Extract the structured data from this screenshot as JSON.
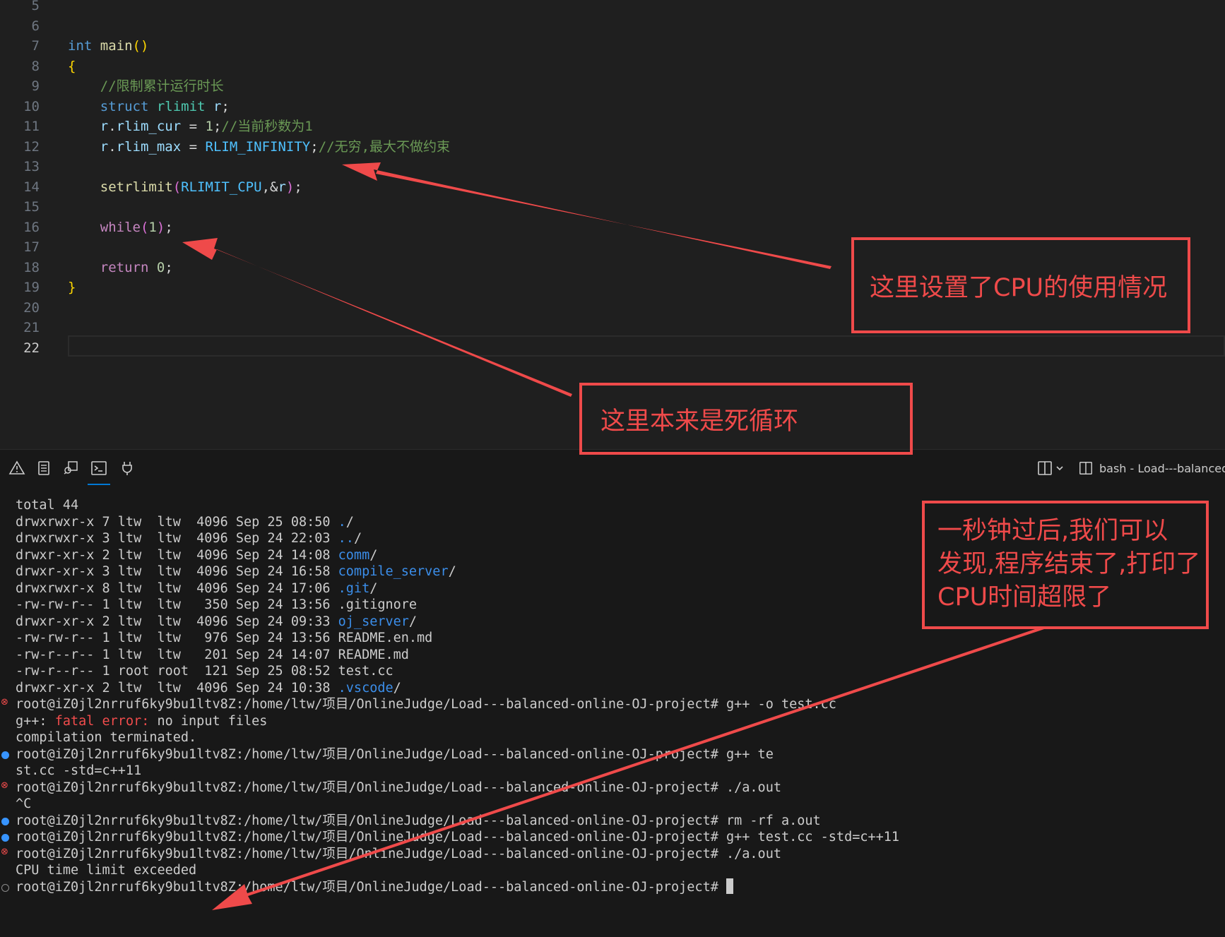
{
  "editor": {
    "lines": [
      {
        "n": "5",
        "tokens": []
      },
      {
        "n": "6",
        "tokens": []
      },
      {
        "n": "7",
        "tokens": [
          [
            "kw",
            "int"
          ],
          [
            "op",
            " "
          ],
          [
            "fn",
            "main"
          ],
          [
            "br",
            "()"
          ]
        ]
      },
      {
        "n": "8",
        "tokens": [
          [
            "br",
            "{"
          ]
        ]
      },
      {
        "n": "9",
        "tokens": [
          [
            "op",
            "    "
          ],
          [
            "cmt",
            "//限制累计运行时长"
          ]
        ]
      },
      {
        "n": "10",
        "tokens": [
          [
            "op",
            "    "
          ],
          [
            "kw",
            "struct"
          ],
          [
            "op",
            " "
          ],
          [
            "typ",
            "rlimit"
          ],
          [
            "op",
            " "
          ],
          [
            "var",
            "r"
          ],
          [
            "op",
            ";"
          ]
        ]
      },
      {
        "n": "11",
        "tokens": [
          [
            "op",
            "    "
          ],
          [
            "var",
            "r"
          ],
          [
            "op",
            "."
          ],
          [
            "var",
            "rlim_cur"
          ],
          [
            "op",
            " = "
          ],
          [
            "num",
            "1"
          ],
          [
            "op",
            ";"
          ],
          [
            "cmt",
            "//当前秒数为1"
          ]
        ]
      },
      {
        "n": "12",
        "tokens": [
          [
            "op",
            "    "
          ],
          [
            "var",
            "r"
          ],
          [
            "op",
            "."
          ],
          [
            "var",
            "rlim_max"
          ],
          [
            "op",
            " = "
          ],
          [
            "mac",
            "RLIM_INFINITY"
          ],
          [
            "op",
            ";"
          ],
          [
            "cmt",
            "//无穷,最大不做约束"
          ]
        ]
      },
      {
        "n": "13",
        "tokens": []
      },
      {
        "n": "14",
        "tokens": [
          [
            "op",
            "    "
          ],
          [
            "fn",
            "setrlimit"
          ],
          [
            "br2",
            "("
          ],
          [
            "mac",
            "RLIMIT_CPU"
          ],
          [
            "op",
            ",&"
          ],
          [
            "var",
            "r"
          ],
          [
            "br2",
            ")"
          ],
          [
            "op",
            ";"
          ]
        ]
      },
      {
        "n": "15",
        "tokens": []
      },
      {
        "n": "16",
        "tokens": [
          [
            "op",
            "    "
          ],
          [
            "ctl",
            "while"
          ],
          [
            "br2",
            "("
          ],
          [
            "num",
            "1"
          ],
          [
            "br2",
            ")"
          ],
          [
            "op",
            ";"
          ]
        ]
      },
      {
        "n": "17",
        "tokens": []
      },
      {
        "n": "18",
        "tokens": [
          [
            "op",
            "    "
          ],
          [
            "ctl",
            "return"
          ],
          [
            "op",
            " "
          ],
          [
            "num",
            "0"
          ],
          [
            "op",
            ";"
          ]
        ]
      },
      {
        "n": "19",
        "tokens": [
          [
            "br",
            "}"
          ]
        ]
      },
      {
        "n": "20",
        "tokens": []
      },
      {
        "n": "21",
        "tokens": []
      },
      {
        "n": "22",
        "tokens": []
      }
    ],
    "active_line": "22"
  },
  "panel": {
    "tab_icons": [
      "warning-icon",
      "output-icon",
      "debug-console-icon",
      "terminal-icon",
      "ports-icon"
    ],
    "terminal_title": "bash - Load---balanced-"
  },
  "terminal": {
    "lines": [
      {
        "deco": "",
        "segs": [
          [
            "",
            "total 44"
          ]
        ]
      },
      {
        "deco": "",
        "segs": [
          [
            "",
            "drwxrwxr-x 7 ltw  ltw  4096 Sep 25 08:50 "
          ],
          [
            "tdir",
            "."
          ],
          [
            "",
            "/"
          ]
        ]
      },
      {
        "deco": "",
        "segs": [
          [
            "",
            "drwxrwxr-x 3 ltw  ltw  4096 Sep 24 22:03 "
          ],
          [
            "tdir",
            ".."
          ],
          [
            "",
            "/"
          ]
        ]
      },
      {
        "deco": "",
        "segs": [
          [
            "",
            "drwxr-xr-x 2 ltw  ltw  4096 Sep 24 14:08 "
          ],
          [
            "tdir",
            "comm"
          ],
          [
            "",
            "/"
          ]
        ]
      },
      {
        "deco": "",
        "segs": [
          [
            "",
            "drwxr-xr-x 3 ltw  ltw  4096 Sep 24 16:58 "
          ],
          [
            "tdir",
            "compile_server"
          ],
          [
            "",
            "/"
          ]
        ]
      },
      {
        "deco": "",
        "segs": [
          [
            "",
            "drwxrwxr-x 8 ltw  ltw  4096 Sep 24 17:06 "
          ],
          [
            "tdir",
            ".git"
          ],
          [
            "",
            "/"
          ]
        ]
      },
      {
        "deco": "",
        "segs": [
          [
            "",
            "-rw-rw-r-- 1 ltw  ltw   350 Sep 24 13:56 .gitignore"
          ]
        ]
      },
      {
        "deco": "",
        "segs": [
          [
            "",
            "drwxr-xr-x 2 ltw  ltw  4096 Sep 24 09:33 "
          ],
          [
            "tdir",
            "oj_server"
          ],
          [
            "",
            "/"
          ]
        ]
      },
      {
        "deco": "",
        "segs": [
          [
            "",
            "-rw-rw-r-- 1 ltw  ltw   976 Sep 24 13:56 README.en.md"
          ]
        ]
      },
      {
        "deco": "",
        "segs": [
          [
            "",
            "-rw-r--r-- 1 ltw  ltw   201 Sep 24 14:07 README.md"
          ]
        ]
      },
      {
        "deco": "",
        "segs": [
          [
            "",
            "-rw-r--r-- 1 root root  121 Sep 25 08:52 test.cc"
          ]
        ]
      },
      {
        "deco": "",
        "segs": [
          [
            "",
            "drwxr-xr-x 2 ltw  ltw  4096 Sep 24 10:38 "
          ],
          [
            "tdir",
            ".vscode"
          ],
          [
            "",
            "/"
          ]
        ]
      },
      {
        "deco": "err",
        "segs": [
          [
            "",
            "root@iZ0jl2nrruf6ky9bu1ltv8Z:/home/ltw/项目/OnlineJudge/Load---balanced-online-OJ-project# g++ -o test.cc"
          ]
        ]
      },
      {
        "deco": "",
        "segs": [
          [
            "",
            "g++: "
          ],
          [
            "tred",
            "fatal error:"
          ],
          [
            "",
            " no input files"
          ]
        ]
      },
      {
        "deco": "",
        "segs": [
          [
            "",
            "compilation terminated."
          ]
        ]
      },
      {
        "deco": "ok",
        "segs": [
          [
            "",
            "root@iZ0jl2nrruf6ky9bu1ltv8Z:/home/ltw/项目/OnlineJudge/Load---balanced-online-OJ-project# g++ te"
          ]
        ]
      },
      {
        "deco": "",
        "segs": [
          [
            "",
            "st.cc -std=c++11"
          ]
        ]
      },
      {
        "deco": "err",
        "segs": [
          [
            "",
            "root@iZ0jl2nrruf6ky9bu1ltv8Z:/home/ltw/项目/OnlineJudge/Load---balanced-online-OJ-project# ./a.out"
          ]
        ]
      },
      {
        "deco": "",
        "segs": [
          [
            "",
            "^C"
          ]
        ]
      },
      {
        "deco": "ok",
        "segs": [
          [
            "",
            "root@iZ0jl2nrruf6ky9bu1ltv8Z:/home/ltw/项目/OnlineJudge/Load---balanced-online-OJ-project# rm -rf a.out"
          ]
        ]
      },
      {
        "deco": "ok",
        "segs": [
          [
            "",
            "root@iZ0jl2nrruf6ky9bu1ltv8Z:/home/ltw/项目/OnlineJudge/Load---balanced-online-OJ-project# g++ test.cc -std=c++11"
          ]
        ]
      },
      {
        "deco": "err",
        "segs": [
          [
            "",
            "root@iZ0jl2nrruf6ky9bu1ltv8Z:/home/ltw/项目/OnlineJudge/Load---balanced-online-OJ-project# ./a.out"
          ]
        ]
      },
      {
        "deco": "",
        "segs": [
          [
            "",
            "CPU time limit exceeded"
          ]
        ]
      },
      {
        "deco": "idle",
        "segs": [
          [
            "",
            "root@iZ0jl2nrruf6ky9bu1ltv8Z:/home/ltw/项目/OnlineJudge/Load---balanced-online-OJ-project# "
          ]
        ],
        "cursor": true
      }
    ]
  },
  "annotations": {
    "color": "#ef4a4a",
    "note_cpu": "这里设置了CPU的使用情况",
    "note_loop": "这里本来是死循环",
    "note_result": [
      "一秒钟过后,我们可以",
      "发现,程序结束了,打印了",
      "CPU时间超限了"
    ]
  }
}
